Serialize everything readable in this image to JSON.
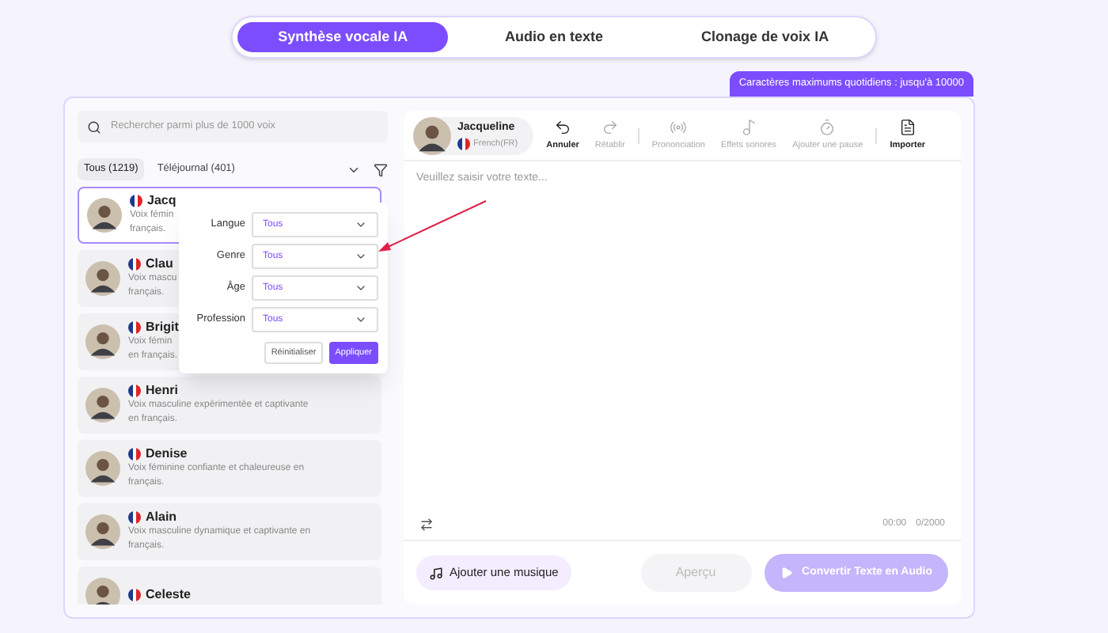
{
  "mode_tabs": [
    {
      "label": "Synthèse vocale IA",
      "selected": true
    },
    {
      "label": "Audio en texte",
      "selected": false
    },
    {
      "label": "Clonage de voix IA",
      "selected": false
    }
  ],
  "quota_badge": "Caractères maximums quotidiens : jusqu'à 10000",
  "voice_panel": {
    "search": {
      "placeholder": "Rechercher parmi plus de 1000 voix"
    },
    "filter_tabs": [
      {
        "label": "Tous (1219)",
        "selected": true
      },
      {
        "label": "Téléjournal (401)",
        "selected": false
      }
    ],
    "voices": [
      {
        "name": "Jacq",
        "description": "Voix fémin",
        "description_2": "français.",
        "selected": true
      },
      {
        "name": "Clau",
        "description": "Voix mascu",
        "description_2": "français.",
        "selected": false
      },
      {
        "name": "Brigit",
        "description": "Voix fémin",
        "description_2": "en français.",
        "selected": false
      },
      {
        "name": "Henri",
        "description": "Voix masculine expérimentée et captivante",
        "description_2": "en français.",
        "selected": false
      },
      {
        "name": "Denise",
        "description": "Voix féminine confiante et chaleureuse en",
        "description_2": "français.",
        "selected": false
      },
      {
        "name": "Alain",
        "description": "Voix masculine dynamique et captivante en",
        "description_2": "français.",
        "selected": false
      },
      {
        "name": "Celeste",
        "selected": false
      }
    ],
    "filter_popup": {
      "fields": [
        {
          "label": "Langue",
          "value": "Tous"
        },
        {
          "label": "Genre",
          "value": "Tous"
        },
        {
          "label": "Âge",
          "value": "Tous"
        },
        {
          "label": "Profession",
          "value": "Tous"
        }
      ],
      "reset_button": "Réinitialiser",
      "apply_button": "Appliquer"
    }
  },
  "editor": {
    "voice": {
      "name": "Jacqueline",
      "language": "French(FR)"
    },
    "toolbar": [
      {
        "label": "Annuler",
        "disabled": false
      },
      {
        "label": "Rétablir",
        "disabled": true
      },
      {
        "label": "Prononciation",
        "disabled": true
      },
      {
        "label": "Effets sonores",
        "disabled": true
      },
      {
        "label": "Ajouter une pause",
        "disabled": true
      },
      {
        "label": "Importer",
        "disabled": false
      }
    ],
    "placeholder": "Veuillez saisir votre texte...",
    "time": "00:00",
    "char_count": "0/2000",
    "music_button": "Ajouter une musique",
    "preview_button": {
      "label": "Aperçu",
      "disabled": true
    },
    "convert_button": {
      "label": "Convertir Texte en Audio",
      "disabled": true
    }
  }
}
